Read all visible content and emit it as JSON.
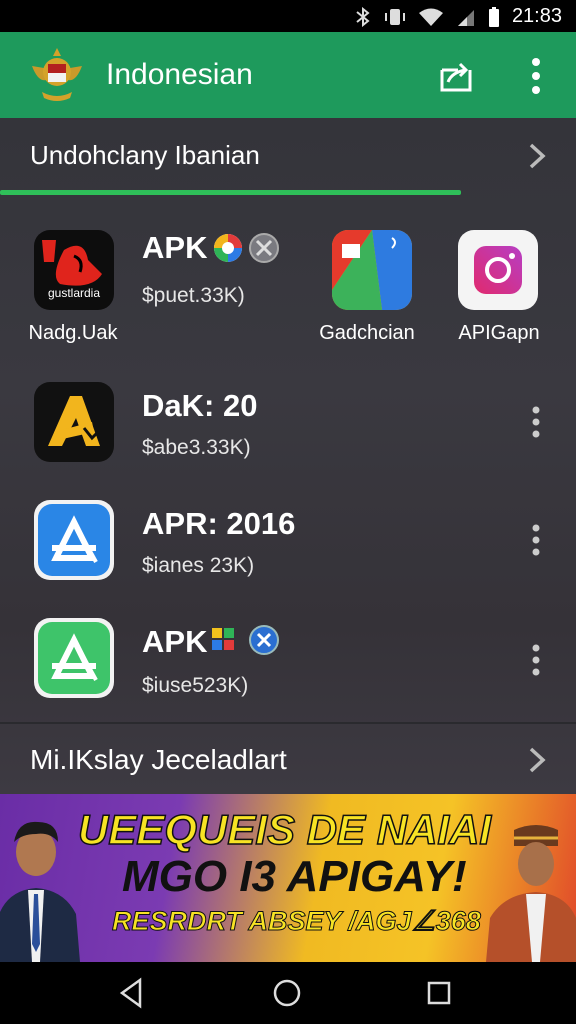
{
  "status_bar": {
    "time": "21:83"
  },
  "app_bar": {
    "title": "Indonesian"
  },
  "section1": {
    "title": "Undohclany Ibanian",
    "progress": 0.8
  },
  "grid": {
    "app1": {
      "icon_text": "gustlardia",
      "label": "Nadg.Uak"
    },
    "app3": {
      "label": "Gadchcian"
    },
    "app4": {
      "label": "APIGapn"
    }
  },
  "featured": {
    "title": "APK",
    "subtitle": "$puet.33K)"
  },
  "list": [
    {
      "title": "DaK: 20",
      "subtitle": "$abe3.33K)"
    },
    {
      "title": "APR: 2016",
      "subtitle": "$ianes 23K)"
    },
    {
      "title": "APK",
      "subtitle": "$iuse523K)"
    }
  ],
  "section2": {
    "title": "Mi.IKslay Jeceladlart"
  },
  "banner": {
    "line1": "UEEQUEIS DE NAIAI",
    "line2": "MGO I3 APIGAY!",
    "line3": "RESRDRT ABSEY /AGJ∠368"
  },
  "colors": {
    "app_bar": "#1e9a5c",
    "progress": "#2fbf59",
    "accent_yellow": "#f7e324"
  },
  "icons": [
    "bluetooth-icon",
    "vibrate-icon",
    "wifi-icon",
    "signal-icon",
    "battery-icon",
    "emblem-logo",
    "share-icon",
    "more-vert-icon",
    "chevron-right-icon",
    "back-icon",
    "home-icon",
    "recents-icon"
  ]
}
